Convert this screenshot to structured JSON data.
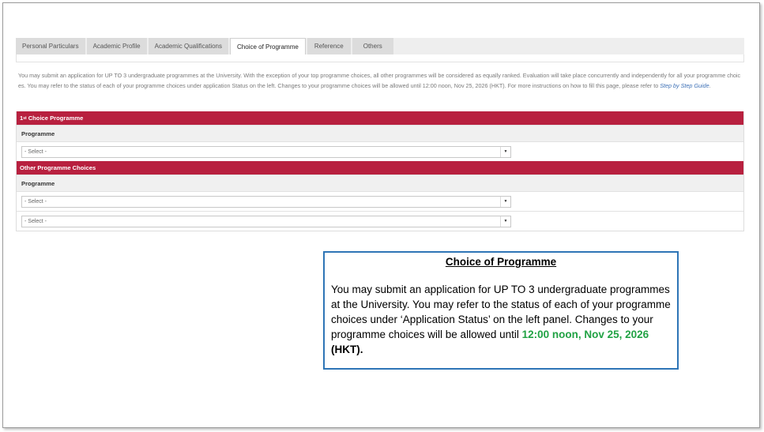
{
  "tabs": [
    {
      "label": "Personal Particulars",
      "active": false
    },
    {
      "label": "Academic Profile",
      "active": false
    },
    {
      "label": "Academic Qualifications",
      "active": false
    },
    {
      "label": "Choice of Programme",
      "active": true
    },
    {
      "label": "Reference",
      "active": false
    },
    {
      "label": "Others",
      "active": false
    }
  ],
  "intro": {
    "text": "You may submit an application for UP TO 3 undergraduate programmes at the University. With the exception of your top programme choices, all other programmes will be considered as equally ranked. Evaluation will take place concurrently and independently for all your programme choices. You may refer to the status of each of your programme choices under application Status on the left. Changes to your programme choices will be allowed until 12:00 noon, Nov 25, 2026 (HKT). For more instructions on how to fill this page, please refer to",
    "link": "Step by Step Guide",
    "end": "."
  },
  "first_choice": {
    "header_num": "1",
    "header_sup": "st",
    "header_rest": "Choice Programme",
    "col_header": "Programme",
    "select_value": "- Select -"
  },
  "other_choices": {
    "header": "Other Programme Choices",
    "col_header": "Programme",
    "select_1": "- Select -",
    "select_2": "- Select -"
  },
  "callout": {
    "title": "Choice of Programme",
    "body": "You may submit an application for UP TO 3 undergraduate programmes at the University. You may refer to the status of each of your programme choices under ‘Application Status’ on the left panel.  Changes to your programme choices will be allowed until ",
    "deadline": "12:00 noon, Nov 25, 2026",
    "suffix": " (HKT).",
    "deadline_color": "#21a244",
    "border_color": "#2e75b6"
  },
  "colors": {
    "section_header": "#b8203f",
    "link": "#3b6fb5"
  }
}
